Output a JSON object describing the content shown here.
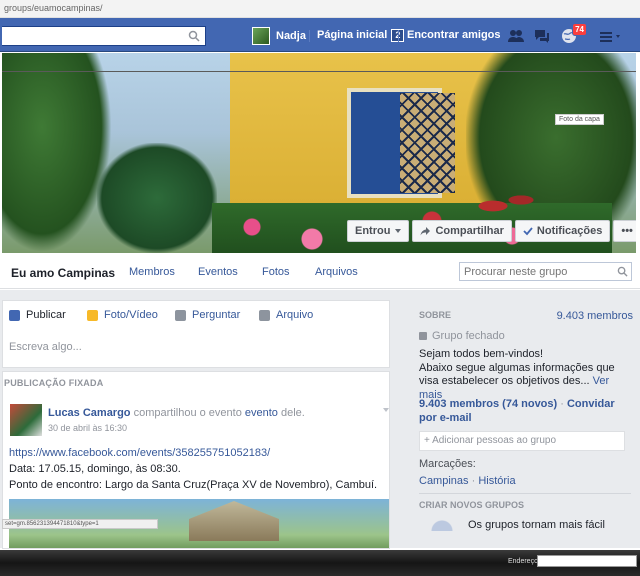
{
  "browser": {
    "url": "groups/euamocampinas/",
    "statusbar": "set=gm.85623139447181​0&type=1",
    "taskbar_address_label": "Endereço"
  },
  "topbar": {
    "user_name": "Nadja",
    "home_label": "Página inicial",
    "home_count": "2",
    "find_friends": "Encontrar amigos",
    "notifications_count": "74",
    "colors": {
      "bar": "#4267b2",
      "badge": "#fa3e3e"
    },
    "icons": [
      "search-icon",
      "friends-icon",
      "messages-icon",
      "globe-icon",
      "settings-icon"
    ]
  },
  "cover": {
    "photo_label": "Foto da capa",
    "buttons": {
      "joined": "Entrou",
      "share": "Compartilhar",
      "notifications": "Notificações",
      "more": "•••"
    }
  },
  "group": {
    "name": "Eu amo Campinas",
    "tabs": [
      "Membros",
      "Eventos",
      "Fotos",
      "Arquivos"
    ],
    "search_placeholder": "Procurar neste grupo"
  },
  "composer": {
    "tabs": [
      "Publicar",
      "Foto/Vídeo",
      "Perguntar",
      "Arquivo"
    ],
    "placeholder": "Escreva algo..."
  },
  "post": {
    "section_label": "PUBLICAÇÃO FIXADA",
    "author": "Lucas Camargo",
    "action_text": "compartilhou o evento",
    "event_link": "evento",
    "suffix": "dele.",
    "time": "30 de abril às 16:30",
    "lines": [
      "https://www.facebook.com/events/358255751052183/",
      "Data: 17.05.15, domingo, às 08:30.",
      "Ponto de encontro: Largo da Santa Cruz(Praça XV de Novembro), Cambuí."
    ]
  },
  "sidebar": {
    "about_label": "SOBRE",
    "member_count": "9.403 membros",
    "privacy": "Grupo fechado",
    "description_1": "Sejam todos bem-vindos!",
    "description_2": "Abaixo segue algumas informações que visa estabelecer os objetivos des...",
    "see_more": "Ver mais",
    "stats_members": "9.403 membros",
    "stats_new": "(74 novos)",
    "invite_email": "Convidar por e-mail",
    "add_people_placeholder": "+ Adicionar pessoas ao grupo",
    "tags_label": "Marcações:",
    "tags": [
      "Campinas",
      "História"
    ],
    "create_groups_label": "CRIAR NOVOS GRUPOS",
    "create_groups_text": "Os grupos tornam mais fácil"
  }
}
